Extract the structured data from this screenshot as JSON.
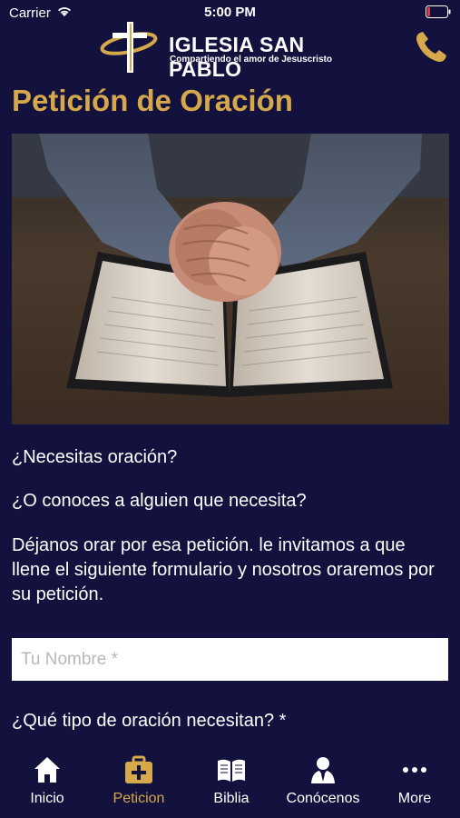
{
  "status_bar": {
    "carrier": "Carrier",
    "time": "5:00 PM"
  },
  "header": {
    "logo_name": "IGLESIA SAN PABLO",
    "logo_tagline": "Compartiendo el amor de Jesuscristo",
    "phone_icon": "phone-icon"
  },
  "page": {
    "title": "Petición de Oración",
    "image_icon": "praying-hands-bible-photo",
    "paragraphs": [
      "¿Necesitas oración?",
      "¿O conoces a alguien que necesita?",
      "Déjanos orar por esa petición. le invitamos a que llene el siguiente formulario y nosotros oraremos por su petición."
    ],
    "name_placeholder": "Tu Nombre *",
    "question_label": "¿Qué tipo de oración necesitan? *"
  },
  "tabs": [
    {
      "label": "Inicio",
      "icon": "home-icon"
    },
    {
      "label": "Peticion",
      "icon": "medical-kit-icon",
      "active": true
    },
    {
      "label": "Biblia",
      "icon": "book-icon"
    },
    {
      "label": "Conócenos",
      "icon": "person-icon"
    },
    {
      "label": "More",
      "icon": "more-icon"
    }
  ],
  "colors": {
    "background": "#13113d",
    "accent": "#d5a84b",
    "text": "#ffffff"
  }
}
